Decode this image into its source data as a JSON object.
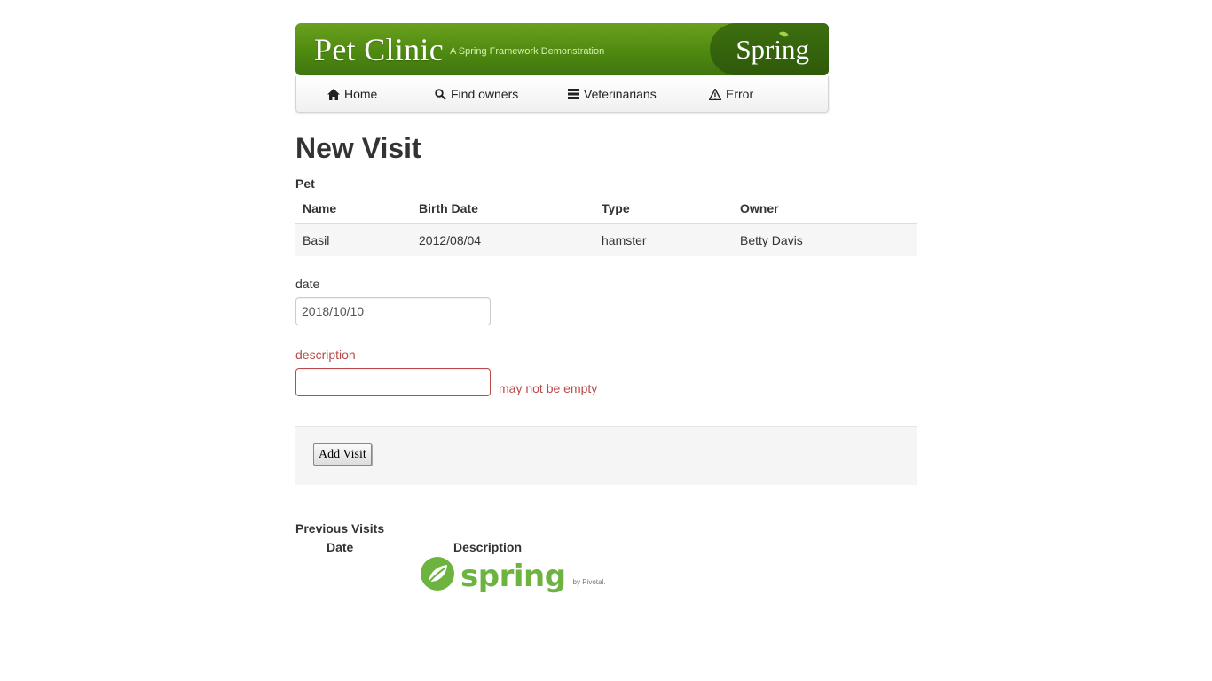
{
  "header": {
    "title": "Pet Clinic",
    "subtitle": "A Spring Framework Demonstration",
    "logo_text": "Spring"
  },
  "nav": {
    "items": [
      {
        "label": "Home",
        "icon": "home-icon"
      },
      {
        "label": "Find owners",
        "icon": "search-icon"
      },
      {
        "label": "Veterinarians",
        "icon": "list-icon"
      },
      {
        "label": "Error",
        "icon": "warning-icon"
      }
    ]
  },
  "page": {
    "title": "New Visit",
    "pet_section_label": "Pet"
  },
  "pet_table": {
    "headers": [
      "Name",
      "Birth Date",
      "Type",
      "Owner"
    ],
    "row": [
      "Basil",
      "2012/08/04",
      "hamster",
      "Betty Davis"
    ]
  },
  "form": {
    "date_label": "date",
    "date_value": "2018/10/10",
    "description_label": "description",
    "description_value": "",
    "description_error": "may not be empty",
    "submit_label": "Add Visit"
  },
  "previous_visits": {
    "title": "Previous Visits",
    "headers": [
      "Date",
      "Description"
    ]
  },
  "footer": {
    "logo_text": "spring",
    "by_text": "by Pivotal."
  },
  "colors": {
    "brand_green": "#6db33f",
    "error_red": "#b94a48"
  }
}
